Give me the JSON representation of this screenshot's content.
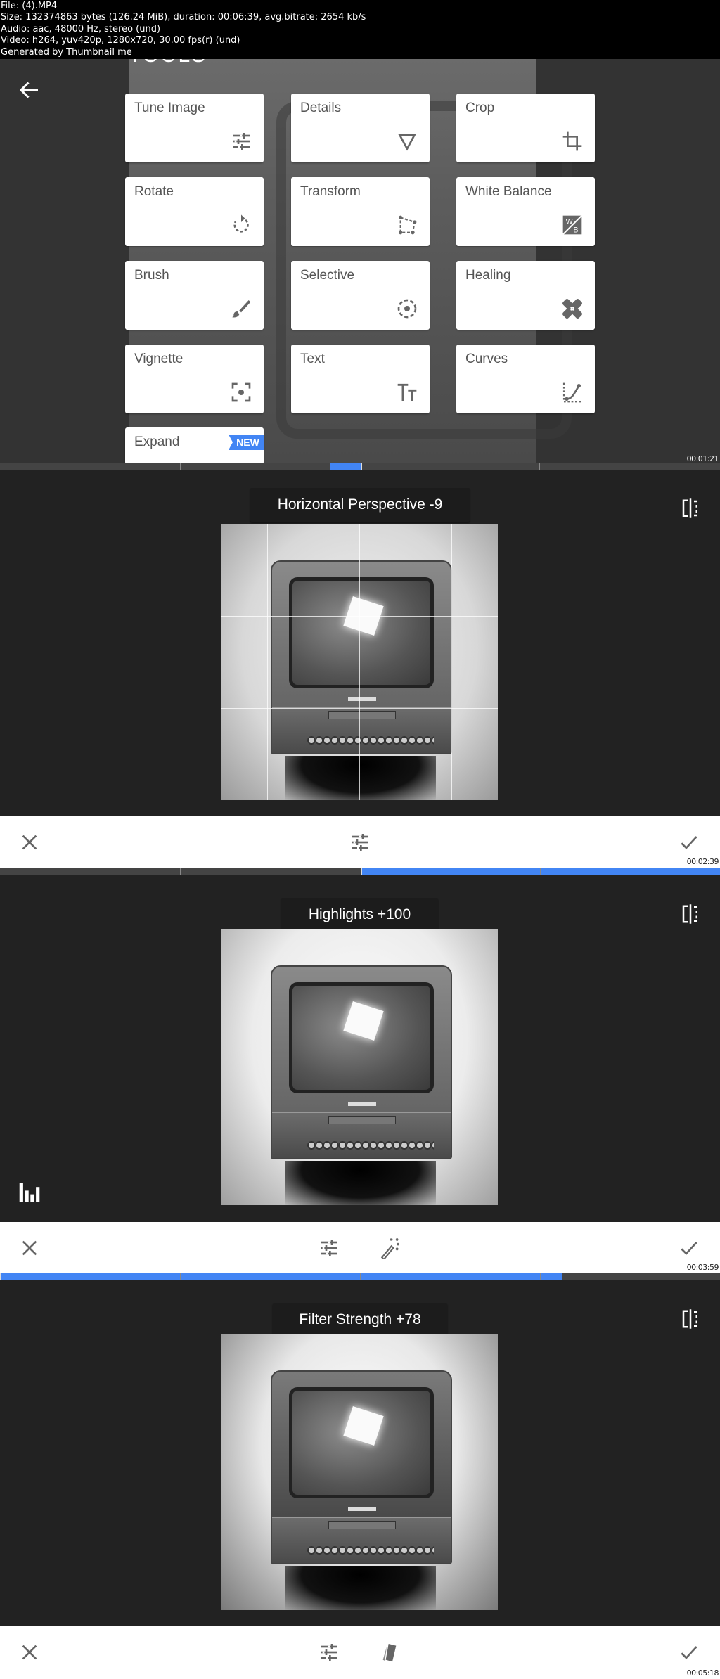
{
  "file_info": {
    "line1": "File:  (4).MP4",
    "line2": "Size: 132374863 bytes (126.24 MiB), duration: 00:06:39, avg.bitrate: 2654 kb/s",
    "line3": "Audio: aac, 48000 Hz, stereo (und)",
    "line4": "Video: h264, yuv420p, 1280x720, 30.00 fps(r) (und)",
    "line5": "Generated by Thumbnail me"
  },
  "frame1": {
    "title": "TOOLS",
    "back_icon": "arrow-left-icon",
    "tools": [
      {
        "label": "Tune Image",
        "icon": "sliders-icon"
      },
      {
        "label": "Details",
        "icon": "triangle-down-icon"
      },
      {
        "label": "Crop",
        "icon": "crop-icon"
      },
      {
        "label": "Rotate",
        "icon": "rotate-icon"
      },
      {
        "label": "Transform",
        "icon": "transform-icon"
      },
      {
        "label": "White Balance",
        "icon": "white-balance-icon"
      },
      {
        "label": "Brush",
        "icon": "brush-icon"
      },
      {
        "label": "Selective",
        "icon": "selective-icon"
      },
      {
        "label": "Healing",
        "icon": "bandage-icon"
      },
      {
        "label": "Vignette",
        "icon": "vignette-icon"
      },
      {
        "label": "Text",
        "icon": "text-icon"
      },
      {
        "label": "Curves",
        "icon": "curves-icon"
      },
      {
        "label": "Expand",
        "icon": "",
        "badge": "NEW"
      }
    ],
    "timestamp": "00:01:21",
    "timeline_progress_start": 0.458,
    "timeline_progress_end": 0.501
  },
  "frame2": {
    "value_label": "Horizontal Perspective -9",
    "cancel_icon": "close-icon",
    "center_icon": "sliders-icon",
    "apply_icon": "check-icon",
    "timestamp": "00:02:39",
    "timeline_progress_start": 0.501,
    "timeline_progress_end": 1.0
  },
  "frame3": {
    "value_label": "Highlights +100",
    "cancel_icon": "close-icon",
    "center_icons": [
      "sliders-icon",
      "magic-wand-icon"
    ],
    "apply_icon": "check-icon",
    "timestamp": "00:03:59",
    "timeline_progress_start": 0.0,
    "timeline_progress_end": 0.781
  },
  "frame4": {
    "value_label": "Filter Strength +78",
    "cancel_icon": "close-icon",
    "center_icons": [
      "sliders-icon",
      "styles-icon"
    ],
    "apply_icon": "check-icon",
    "timestamp": "00:05:18"
  },
  "colors": {
    "accent": "#4285f4",
    "panel_dark": "#222222",
    "tools_bg": "#333333",
    "card": "#ffffff",
    "icon_gray": "#666666"
  }
}
